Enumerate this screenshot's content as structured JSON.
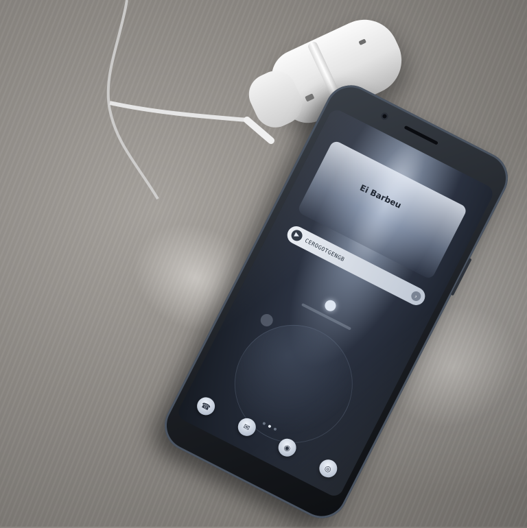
{
  "scene": {
    "description_free": true,
    "colors": {
      "table": "#8d8984",
      "charger": "#e8e8e8",
      "phone_body": "#1b1e23",
      "screen_glow": "#cfd8e6",
      "cable": "#dcdcdc"
    }
  },
  "phone": {
    "hero_text": "Ei Barbeu",
    "notification_text": "CEROGOTGENGB",
    "notification_icon": "play-icon",
    "notification_end_icon": "chevron-icon",
    "dock_icons": [
      "phone-icon",
      "message-icon",
      "camera-icon",
      "browser-icon"
    ]
  }
}
